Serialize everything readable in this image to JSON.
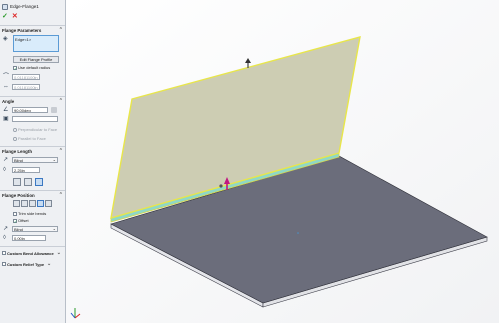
{
  "feature": {
    "title": "Edge-Flange1"
  },
  "actions": {
    "ok": "✓",
    "cancel": "✕"
  },
  "flange_parameters": {
    "heading": "Flange Parameters",
    "edge_item": "Edge<1>",
    "edit_profile": "Edit Flange Profile",
    "use_default_radius": "Use default radius",
    "radius": "0.01181100in",
    "thickness": "0.01181100in"
  },
  "angle": {
    "heading": "Angle",
    "value": "90.00deg",
    "perpendicular": "Perpendicular to Face",
    "parallel": "Parallel to Face"
  },
  "flange_length": {
    "heading": "Flange Length",
    "end_condition": "Blind",
    "value": "2.25in"
  },
  "flange_position": {
    "heading": "Flange Position",
    "trim_side_bends": "Trim side bends",
    "offset": "Offset",
    "offset_condition": "Blind",
    "offset_value": "0.00in"
  },
  "custom_bend_allowance": "Custom Bend Allowance",
  "custom_relief_type": "Custom Relief Type",
  "colors": {
    "flange_fill": "#c9c9ac",
    "base_top": "#6b6d7b",
    "highlight": "#e8e64a",
    "accent": "#c01880"
  }
}
